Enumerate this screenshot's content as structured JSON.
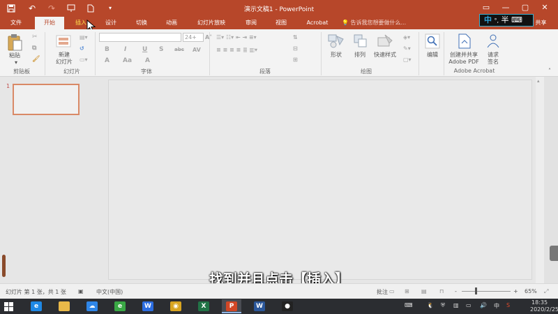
{
  "window": {
    "title": "演示文稿1 - PowerPoint",
    "minimize": "—",
    "close": "✕",
    "share": "共享"
  },
  "ime": {
    "lang": "中",
    "marks": "°,",
    "mode": "半",
    "extra": "⌨"
  },
  "tabs": [
    {
      "label": "文件",
      "active": false
    },
    {
      "label": "开始",
      "active": true
    },
    {
      "label": "插入",
      "active": false
    },
    {
      "label": "设计",
      "active": false
    },
    {
      "label": "切换",
      "active": false
    },
    {
      "label": "动画",
      "active": false
    },
    {
      "label": "幻灯片放映",
      "active": false
    },
    {
      "label": "审阅",
      "active": false
    },
    {
      "label": "视图",
      "active": false
    },
    {
      "label": "Acrobat",
      "active": false
    }
  ],
  "tell_me": "告诉我您想要做什么...",
  "ribbon": {
    "clipboard": {
      "paste": "粘贴",
      "group": "剪贴板"
    },
    "slides": {
      "new_slide_1": "新建",
      "new_slide_2": "幻灯片",
      "group": "幻灯片"
    },
    "font": {
      "size": "24+",
      "group": "字体",
      "bold": "B",
      "italic": "I",
      "underline": "U",
      "shadow": "S",
      "strike": "abc",
      "spacing": "AV",
      "font_a": "A",
      "case": "Aa",
      "clear": "A"
    },
    "paragraph": {
      "group": "段落"
    },
    "drawing": {
      "shapes": "形状",
      "arrange": "排列",
      "quick_styles": "快速样式",
      "group": "绘图"
    },
    "editing": {
      "edit": "编辑"
    },
    "acrobat": {
      "create_share_1": "创建并共享",
      "create_share_2": "Adobe PDF",
      "request_1": "请求",
      "request_2": "签名",
      "group": "Adobe Acrobat"
    }
  },
  "slide_panel": {
    "number": "1"
  },
  "caption": "找到并且点击【插入】",
  "status": {
    "slide_info": "幻灯片 第 1 张，共 1 张",
    "language": "中文(中国)",
    "notes": "备注",
    "comments": "批注",
    "zoom": "65%",
    "minus": "-",
    "plus": "+"
  },
  "taskbar": {
    "time": "18:35",
    "date": "2020/2/25",
    "ime": "中",
    "apps": [
      {
        "name": "ie",
        "color": "#1e88e5",
        "glyph": "e",
        "active": false
      },
      {
        "name": "explorer",
        "color": "#e9b949",
        "glyph": "",
        "active": false
      },
      {
        "name": "baidu-netdisk",
        "color": "#2f86e8",
        "glyph": "☁",
        "active": false
      },
      {
        "name": "360-browser",
        "color": "#3aa845",
        "glyph": "e",
        "active": false
      },
      {
        "name": "wps",
        "color": "#2c6de0",
        "glyph": "W",
        "active": false
      },
      {
        "name": "chrome",
        "color": "#d9a521",
        "glyph": "◉",
        "active": false
      },
      {
        "name": "excel",
        "color": "#217346",
        "glyph": "X",
        "active": false
      },
      {
        "name": "powerpoint",
        "color": "#d24726",
        "glyph": "P",
        "active": true
      },
      {
        "name": "word",
        "color": "#2b579a",
        "glyph": "W",
        "active": false
      },
      {
        "name": "recorder",
        "color": "#222222",
        "glyph": "●",
        "active": false
      }
    ]
  },
  "colors": {
    "accent": "#b7472a",
    "taskbar": "#2b2d31"
  }
}
